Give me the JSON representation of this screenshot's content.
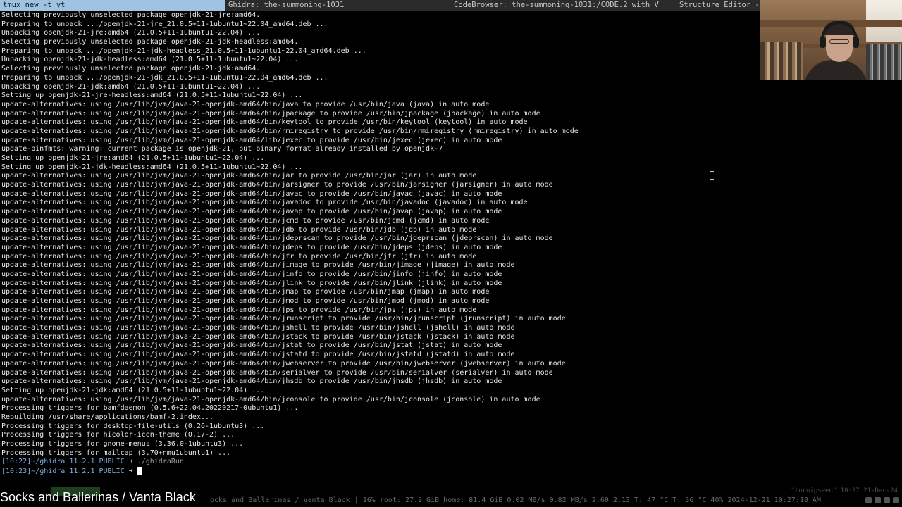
{
  "tabs": [
    {
      "label": "tmux new -t yt",
      "active": true
    },
    {
      "label": "Ghidra: the-summoning-1031",
      "active": false
    },
    {
      "label": "CodeBrowser: the-summoning-1031:/CODE.2 with V",
      "active": false
    },
    {
      "label": "Structure Editor - (",
      "active": false
    }
  ],
  "terminal": {
    "lines": [
      "Selecting previously unselected package openjdk-21-jre:amd64.",
      "Preparing to unpack .../openjdk-21-jre_21.0.5+11-1ubuntu1~22.04_amd64.deb ...",
      "Unpacking openjdk-21-jre:amd64 (21.0.5+11-1ubuntu1~22.04) ...",
      "Selecting previously unselected package openjdk-21-jdk-headless:amd64.",
      "Preparing to unpack .../openjdk-21-jdk-headless_21.0.5+11-1ubuntu1~22.04_amd64.deb ...",
      "Unpacking openjdk-21-jdk-headless:amd64 (21.0.5+11-1ubuntu1~22.04) ...",
      "Selecting previously unselected package openjdk-21-jdk:amd64.",
      "Preparing to unpack .../openjdk-21-jdk_21.0.5+11-1ubuntu1~22.04_amd64.deb ...",
      "Unpacking openjdk-21-jdk:amd64 (21.0.5+11-1ubuntu1~22.04) ...",
      "Setting up openjdk-21-jre-headless:amd64 (21.0.5+11-1ubuntu1~22.04) ...",
      "update-alternatives: using /usr/lib/jvm/java-21-openjdk-amd64/bin/java to provide /usr/bin/java (java) in auto mode",
      "update-alternatives: using /usr/lib/jvm/java-21-openjdk-amd64/bin/jpackage to provide /usr/bin/jpackage (jpackage) in auto mode",
      "update-alternatives: using /usr/lib/jvm/java-21-openjdk-amd64/bin/keytool to provide /usr/bin/keytool (keytool) in auto mode",
      "update-alternatives: using /usr/lib/jvm/java-21-openjdk-amd64/bin/rmiregistry to provide /usr/bin/rmiregistry (rmiregistry) in auto mode",
      "update-alternatives: using /usr/lib/jvm/java-21-openjdk-amd64/lib/jexec to provide /usr/bin/jexec (jexec) in auto mode",
      "update-binfmts: warning: current package is openjdk-21, but binary format already installed by openjdk-7",
      "Setting up openjdk-21-jre:amd64 (21.0.5+11-1ubuntu1~22.04) ...",
      "Setting up openjdk-21-jdk-headless:amd64 (21.0.5+11-1ubuntu1~22.04) ...",
      "update-alternatives: using /usr/lib/jvm/java-21-openjdk-amd64/bin/jar to provide /usr/bin/jar (jar) in auto mode",
      "update-alternatives: using /usr/lib/jvm/java-21-openjdk-amd64/bin/jarsigner to provide /usr/bin/jarsigner (jarsigner) in auto mode",
      "update-alternatives: using /usr/lib/jvm/java-21-openjdk-amd64/bin/javac to provide /usr/bin/javac (javac) in auto mode",
      "update-alternatives: using /usr/lib/jvm/java-21-openjdk-amd64/bin/javadoc to provide /usr/bin/javadoc (javadoc) in auto mode",
      "update-alternatives: using /usr/lib/jvm/java-21-openjdk-amd64/bin/javap to provide /usr/bin/javap (javap) in auto mode",
      "update-alternatives: using /usr/lib/jvm/java-21-openjdk-amd64/bin/jcmd to provide /usr/bin/jcmd (jcmd) in auto mode",
      "update-alternatives: using /usr/lib/jvm/java-21-openjdk-amd64/bin/jdb to provide /usr/bin/jdb (jdb) in auto mode",
      "update-alternatives: using /usr/lib/jvm/java-21-openjdk-amd64/bin/jdeprscan to provide /usr/bin/jdeprscan (jdeprscan) in auto mode",
      "update-alternatives: using /usr/lib/jvm/java-21-openjdk-amd64/bin/jdeps to provide /usr/bin/jdeps (jdeps) in auto mode",
      "update-alternatives: using /usr/lib/jvm/java-21-openjdk-amd64/bin/jfr to provide /usr/bin/jfr (jfr) in auto mode",
      "update-alternatives: using /usr/lib/jvm/java-21-openjdk-amd64/bin/jimage to provide /usr/bin/jimage (jimage) in auto mode",
      "update-alternatives: using /usr/lib/jvm/java-21-openjdk-amd64/bin/jinfo to provide /usr/bin/jinfo (jinfo) in auto mode",
      "update-alternatives: using /usr/lib/jvm/java-21-openjdk-amd64/bin/jlink to provide /usr/bin/jlink (jlink) in auto mode",
      "update-alternatives: using /usr/lib/jvm/java-21-openjdk-amd64/bin/jmap to provide /usr/bin/jmap (jmap) in auto mode",
      "update-alternatives: using /usr/lib/jvm/java-21-openjdk-amd64/bin/jmod to provide /usr/bin/jmod (jmod) in auto mode",
      "update-alternatives: using /usr/lib/jvm/java-21-openjdk-amd64/bin/jps to provide /usr/bin/jps (jps) in auto mode",
      "update-alternatives: using /usr/lib/jvm/java-21-openjdk-amd64/bin/jrunscript to provide /usr/bin/jrunscript (jrunscript) in auto mode",
      "update-alternatives: using /usr/lib/jvm/java-21-openjdk-amd64/bin/jshell to provide /usr/bin/jshell (jshell) in auto mode",
      "update-alternatives: using /usr/lib/jvm/java-21-openjdk-amd64/bin/jstack to provide /usr/bin/jstack (jstack) in auto mode",
      "update-alternatives: using /usr/lib/jvm/java-21-openjdk-amd64/bin/jstat to provide /usr/bin/jstat (jstat) in auto mode",
      "update-alternatives: using /usr/lib/jvm/java-21-openjdk-amd64/bin/jstatd to provide /usr/bin/jstatd (jstatd) in auto mode",
      "update-alternatives: using /usr/lib/jvm/java-21-openjdk-amd64/bin/jwebserver to provide /usr/bin/jwebserver (jwebserver) in auto mode",
      "update-alternatives: using /usr/lib/jvm/java-21-openjdk-amd64/bin/serialver to provide /usr/bin/serialver (serialver) in auto mode",
      "update-alternatives: using /usr/lib/jvm/java-21-openjdk-amd64/bin/jhsdb to provide /usr/bin/jhsdb (jhsdb) in auto mode",
      "Setting up openjdk-21-jdk:amd64 (21.0.5+11-1ubuntu1~22.04) ...",
      "update-alternatives: using /usr/lib/jvm/java-21-openjdk-amd64/bin/jconsole to provide /usr/bin/jconsole (jconsole) in auto mode",
      "Processing triggers for bamfdaemon (0.5.6+22.04.20220217-0ubuntu1) ...",
      "Rebuilding /usr/share/applications/bamf-2.index...",
      "Processing triggers for desktop-file-utils (0.26-1ubuntu3) ...",
      "Processing triggers for hicolor-icon-theme (0.17-2) ...",
      "Processing triggers for gnome-menus (3.36.0-1ubuntu3) ...",
      "Processing triggers for mailcap (3.70+nmu1ubuntu1) ..."
    ],
    "prompts": [
      {
        "time": "[10:22]",
        "path": "~/ghidra_11.2.1_PUBLIC",
        "arrow": "➜",
        "command": "./ghidraRun"
      },
      {
        "time": "[10:23]",
        "path": "~/ghidra_11.2.1_PUBLIC",
        "arrow": "➜",
        "command": ""
      }
    ]
  },
  "status": {
    "now_playing": "Socks and Ballerinas / Vanta Black",
    "sysinfo": "ocks and Ballerinas / Vanta Black  | 16% root: 27.9 GiB home: 81.4 GiB 0.02 MB/s 0.82 MB/s 2.60 2.13 T: 47 °C T: 36 °C  40% 2024-12-21 10:27:18 AM",
    "tmux_right": "\"turnipseed\" 10:27 21-Dec-24"
  },
  "colors": {
    "active_tab": "#9fc3e0",
    "prompt": "#7fb0e0"
  }
}
